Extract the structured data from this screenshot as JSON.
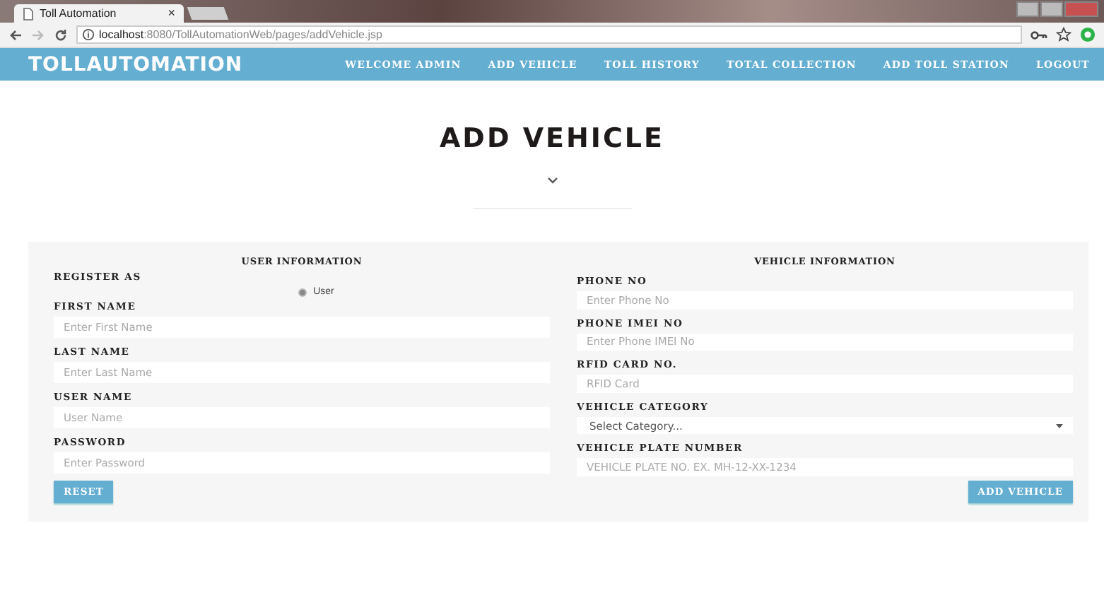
{
  "browser": {
    "tab_title": "Toll Automation",
    "tab_close": "×",
    "url_host": "localhost",
    "url_rest": ":8080/TollAutomationWeb/pages/addVehicle.jsp"
  },
  "nav": {
    "brand": "TOLLAUTOMATION",
    "items": [
      "WELCOME ADMIN",
      "ADD VEHICLE",
      "TOLL HISTORY",
      "TOTAL COLLECTION",
      "ADD TOLL STATION",
      "LOGOUT"
    ]
  },
  "page_title": "ADD VEHICLE",
  "user_section": {
    "heading": "USER INFORMATION",
    "register_label": "REGISTER AS",
    "roles": [
      {
        "label": "User",
        "selected": true
      }
    ],
    "fields": [
      {
        "kind": "input",
        "label": "FIRST NAME",
        "placeholder": "Enter First Name"
      },
      {
        "kind": "input",
        "label": "LAST NAME",
        "placeholder": "Enter Last Name"
      },
      {
        "kind": "input",
        "label": "USER NAME",
        "placeholder": "User Name"
      },
      {
        "kind": "input",
        "label": "PASSWORD",
        "placeholder": "Enter Password"
      }
    ],
    "button": "RESET"
  },
  "vehicle_section": {
    "heading": "VEHICLE INFORMATION",
    "fields": [
      {
        "kind": "input",
        "label": "PHONE NO",
        "placeholder": "Enter Phone No"
      },
      {
        "kind": "input",
        "label": "PHONE IMEI NO",
        "placeholder": "Enter Phone IMEI No"
      },
      {
        "kind": "input",
        "label": "RFID CARD NO.",
        "placeholder": "RFID Card"
      },
      {
        "kind": "select",
        "label": "VEHICLE CATEGORY",
        "value": "Select Category..."
      },
      {
        "kind": "input",
        "label": "VEHICLE PLATE NUMBER",
        "placeholder": "VEHICLE PLATE NO. EX. MH-12-XX-1234"
      }
    ],
    "button": "ADD VEHICLE"
  }
}
